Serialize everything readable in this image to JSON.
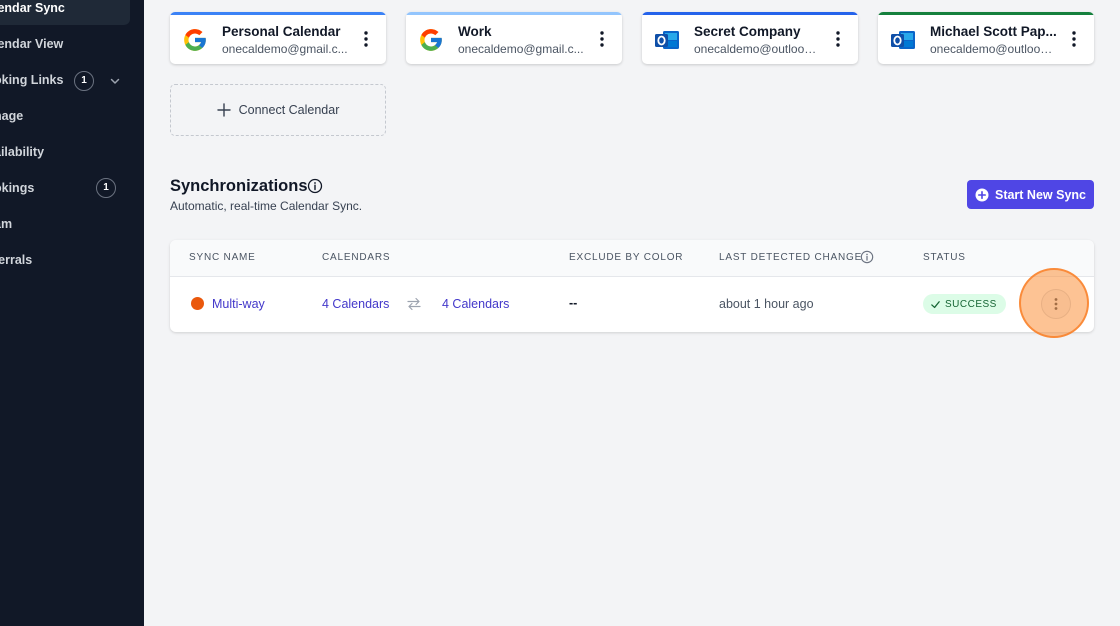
{
  "sidebar": {
    "items": [
      {
        "label": "lendar Sync",
        "active": true
      },
      {
        "label": "lendar View"
      },
      {
        "label": "oking Links",
        "badge": "1"
      },
      {
        "label": "nage"
      },
      {
        "label": "ailability"
      },
      {
        "label": "okings",
        "badge": "1"
      },
      {
        "label": "am"
      },
      {
        "label": "ferrals"
      }
    ]
  },
  "calendars": [
    {
      "name": "Personal Calendar",
      "email": "onecaldemo@gmail.c...",
      "provider": "google-icon",
      "accent": "#3b82f6"
    },
    {
      "name": "Work",
      "email": "onecaldemo@gmail.c...",
      "provider": "google-icon",
      "accent": "#93c5fd"
    },
    {
      "name": "Secret Company",
      "email": "onecaldemo@outlook...",
      "provider": "outlook-icon",
      "accent": "#2563eb"
    },
    {
      "name": "Michael Scott Pap...",
      "email": "onecaldemo@outlook...",
      "provider": "outlook-icon",
      "accent": "#15803d"
    }
  ],
  "connect_label": "Connect Calendar",
  "sync": {
    "title": "Synchronizations",
    "subtitle": "Automatic, real-time Calendar Sync.",
    "start_label": "Start New Sync"
  },
  "table": {
    "headers": [
      "SYNC NAME",
      "CALENDARS",
      "EXCLUDE BY COLOR",
      "LAST DETECTED CHANGE",
      "STATUS"
    ],
    "rows": [
      {
        "name": "Multi-way",
        "left": "4 Calendars",
        "right": "4 Calendars",
        "exclude": "--",
        "last_change": "about 1 hour ago",
        "status": "SUCCESS",
        "color": "#ea580c"
      }
    ]
  }
}
